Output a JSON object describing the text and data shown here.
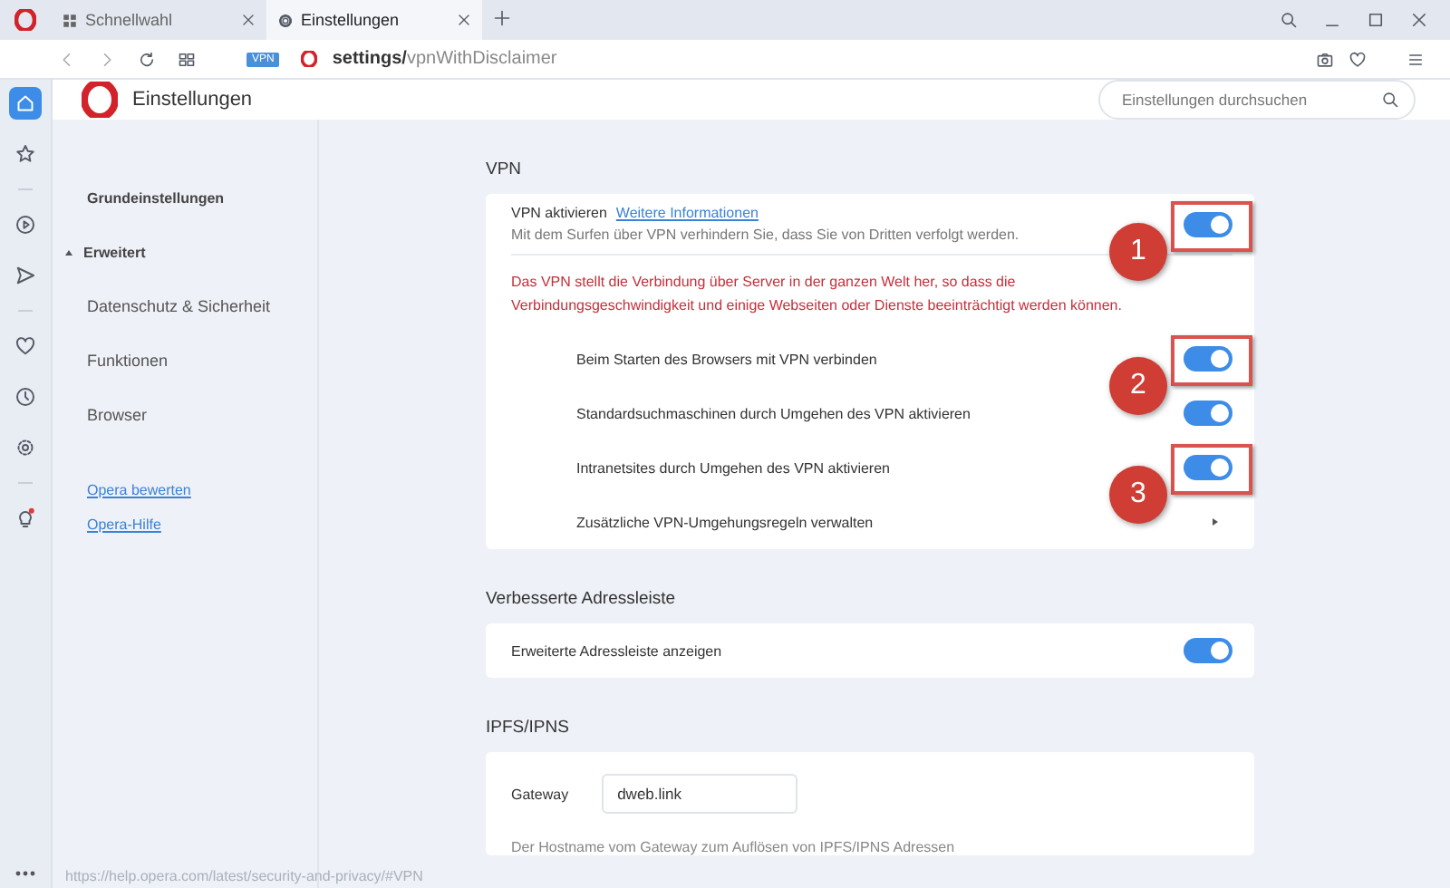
{
  "tabs": [
    {
      "label": "Schnellwahl",
      "selected": false
    },
    {
      "label": "Einstellungen",
      "selected": true
    }
  ],
  "address_bar": {
    "vpn_badge": "VPN",
    "url_host": "settings/",
    "url_path": "vpnWithDisclaimer"
  },
  "rail": [
    {
      "kind": "home",
      "selected": true
    },
    {
      "kind": "star",
      "selected": false
    },
    {
      "kind": "separator"
    },
    {
      "kind": "play",
      "selected": false
    },
    {
      "kind": "send",
      "selected": false
    },
    {
      "kind": "separator"
    },
    {
      "kind": "heart",
      "selected": false
    },
    {
      "kind": "clock",
      "selected": false
    },
    {
      "kind": "gear",
      "selected": false
    },
    {
      "kind": "separator"
    },
    {
      "kind": "bulb",
      "selected": false
    }
  ],
  "header": {
    "title": "Einstellungen",
    "search_placeholder": "Einstellungen durchsuchen"
  },
  "nav": {
    "items": [
      {
        "label": "Grundeinstellungen",
        "kind": "heading"
      },
      {
        "label": "Erweitert",
        "kind": "section",
        "expanded": true
      },
      {
        "label": "Datenschutz & Sicherheit",
        "kind": "item"
      },
      {
        "label": "Funktionen",
        "kind": "item"
      },
      {
        "label": "Browser",
        "kind": "item"
      }
    ],
    "links": [
      "Opera bewerten",
      "Opera-Hilfe"
    ]
  },
  "vpn": {
    "heading": "VPN",
    "title": "VPN aktivieren",
    "link": "Weitere Informationen",
    "description": "Mit dem Surfen über VPN verhindern Sie, dass Sie von Dritten verfolgt werden.",
    "on": true,
    "callout": "1",
    "warning": "Das VPN stellt die Verbindung über Server in der ganzen Welt her, so dass die Verbindungsgeschwindigkeit und einige Webseiten oder Dienste beeinträchtigt werden können.",
    "rows": [
      {
        "kind": "toggle",
        "label": "Beim Starten des Browsers mit VPN verbinden",
        "on": true,
        "callout": "2"
      },
      {
        "kind": "toggle",
        "label": "Standardsuchmaschinen durch Umgehen des VPN aktivieren",
        "on": true
      },
      {
        "kind": "toggle",
        "label": "Intranetsites durch Umgehen des VPN aktivieren",
        "on": true,
        "callout": "3"
      },
      {
        "kind": "link",
        "label": "Zusätzliche VPN-Umgehungsregeln verwalten"
      }
    ]
  },
  "address_section": {
    "heading": "Verbesserte Adressleiste",
    "rows": [
      {
        "kind": "toggle",
        "label": "Erweiterte Adressleiste anzeigen",
        "on": true
      }
    ]
  },
  "ipfs": {
    "heading": "IPFS/IPNS",
    "gateway_label": "Gateway",
    "gateway_value": "dweb.link",
    "description": "Der Hostname vom Gateway zum Auflösen von IPFS/IPNS Adressen"
  },
  "status_url": "https://help.opera.com/latest/security-and-privacy/#VPN"
}
